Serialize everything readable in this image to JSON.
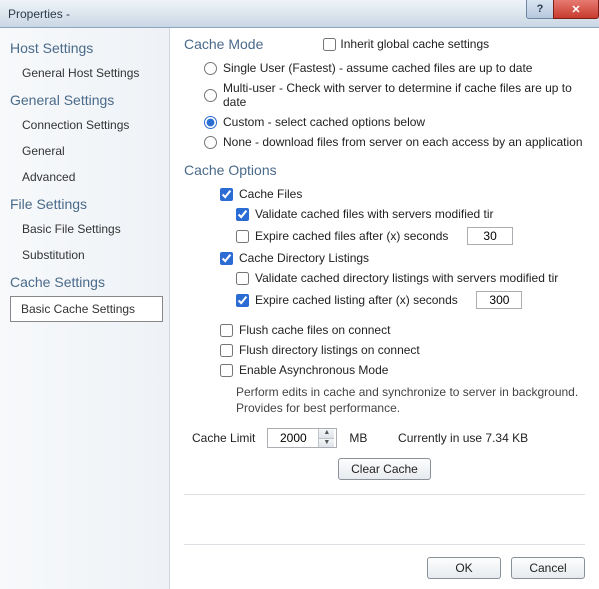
{
  "window": {
    "title": "Properties -",
    "help": "?",
    "close": "✕"
  },
  "sidebar": {
    "groups": [
      {
        "heading": "Host Settings",
        "items": [
          {
            "label": "General Host Settings",
            "selected": false
          }
        ]
      },
      {
        "heading": "General Settings",
        "items": [
          {
            "label": "Connection Settings",
            "selected": false
          },
          {
            "label": "General",
            "selected": false
          },
          {
            "label": "Advanced",
            "selected": false
          }
        ]
      },
      {
        "heading": "File Settings",
        "items": [
          {
            "label": "Basic File Settings",
            "selected": false
          },
          {
            "label": "Substitution",
            "selected": false
          }
        ]
      },
      {
        "heading": "Cache Settings",
        "items": [
          {
            "label": "Basic Cache Settings",
            "selected": true
          }
        ]
      }
    ]
  },
  "cache_mode": {
    "title": "Cache Mode",
    "inherit_label": "Inherit global cache settings",
    "inherit_checked": false,
    "options": [
      {
        "id": "single",
        "label": "Single User (Fastest) - assume cached files are up to date",
        "checked": false
      },
      {
        "id": "multi",
        "label": "Multi-user - Check with server to determine if cache files are up to date",
        "checked": false
      },
      {
        "id": "custom",
        "label": "Custom - select cached options below",
        "checked": true
      },
      {
        "id": "none",
        "label": "None - download files from server on each access by an application",
        "checked": false
      }
    ]
  },
  "cache_options": {
    "title": "Cache Options",
    "cache_files": {
      "label": "Cache Files",
      "checked": true
    },
    "validate_files": {
      "label": "Validate cached files with servers modified tir",
      "checked": true
    },
    "expire_files": {
      "label": "Expire cached files after (x) seconds",
      "checked": false,
      "value": "30"
    },
    "cache_dir": {
      "label": "Cache Directory Listings",
      "checked": true
    },
    "validate_dir": {
      "label": "Validate cached directory listings with servers modified tir",
      "checked": false
    },
    "expire_dir": {
      "label": "Expire cached listing after (x) seconds",
      "checked": true,
      "value": "300"
    },
    "flush_files": {
      "label": "Flush cache files on connect",
      "checked": false
    },
    "flush_dir": {
      "label": "Flush directory listings on connect",
      "checked": false
    },
    "async": {
      "label": "Enable Asynchronous Mode",
      "checked": false
    },
    "async_help": "Perform edits in cache and synchronize to server in background. Provides for best performance.",
    "limit_label": "Cache Limit",
    "limit_value": "2000",
    "limit_unit": "MB",
    "in_use_label": "Currently in use 7.34 KB",
    "clear_label": "Clear Cache"
  },
  "footer": {
    "ok": "OK",
    "cancel": "Cancel"
  }
}
